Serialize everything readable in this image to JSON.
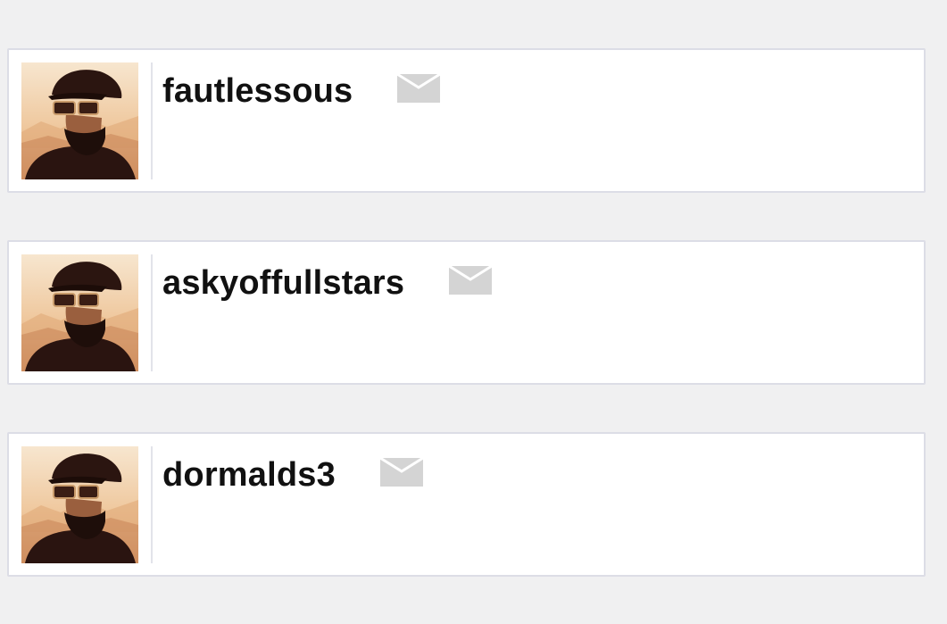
{
  "users": [
    {
      "username": "fautlessous",
      "avatar_icon": "avatar-photo",
      "message_icon": "mail-icon"
    },
    {
      "username": "askyoffullstars",
      "avatar_icon": "avatar-photo",
      "message_icon": "mail-icon"
    },
    {
      "username": "dormalds3",
      "avatar_icon": "avatar-photo",
      "message_icon": "mail-icon"
    }
  ],
  "colors": {
    "background": "#f0f0f1",
    "card": "#ffffff",
    "card_border": "#dcdde6",
    "username_text": "#111111",
    "mail_icon": "#d4d4d4"
  }
}
